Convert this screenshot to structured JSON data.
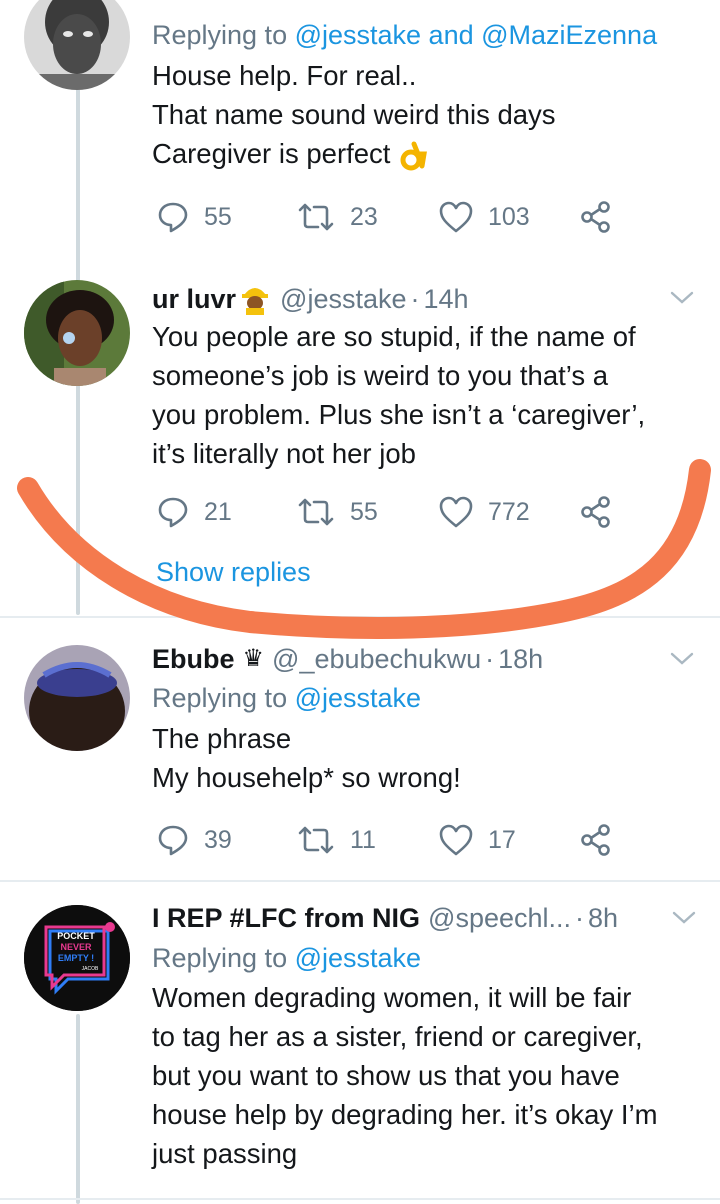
{
  "tweets": [
    {
      "replying_prefix": "Replying to ",
      "replying_mentions": "@jesstake and @MaziEzenna",
      "lines": [
        "House help. For real..",
        "That name sound weird this days",
        "Caregiver is perfect"
      ],
      "emoji_icon": "ok-hand-icon",
      "stats": {
        "replies": "55",
        "retweets": "23",
        "likes": "103"
      }
    },
    {
      "display_name": "ur luvr",
      "emoji_icon": "construction-worker-icon",
      "handle": "@jesstake",
      "dot": "·",
      "time": "14h",
      "lines": [
        "You people are so stupid, if the name of",
        "someone’s job is weird to you that’s a",
        "you problem. Plus she isn’t a ‘caregiver’,",
        "it’s literally not her job"
      ],
      "stats": {
        "replies": "21",
        "retweets": "55",
        "likes": "772"
      },
      "show_replies": "Show replies"
    },
    {
      "display_name": "Ebube",
      "name_symbol": "♛",
      "handle": "@_ebubechukwu",
      "dot": "·",
      "time": "18h",
      "replying_prefix": "Replying to ",
      "replying_mentions": "@jesstake",
      "lines": [
        "The phrase",
        "My househelp* so wrong!"
      ],
      "stats": {
        "replies": "39",
        "retweets": "11",
        "likes": "17"
      }
    },
    {
      "display_name": "I REP #LFC from NIG",
      "handle": "@speechl...",
      "dot": "·",
      "time": "8h",
      "replying_prefix": "Replying to ",
      "replying_mentions": "@jesstake",
      "lines": [
        "Women degrading women, it will be fair",
        "to tag her as a sister, friend or caregiver,",
        "but you want to show us that you have",
        "house help by degrading her. it’s okay I’m",
        "just passing"
      ],
      "avatar_text": [
        "POCKET",
        "NEVER",
        "EMPTY !",
        "JACOB"
      ]
    }
  ],
  "colors": {
    "link": "#1b95e0",
    "secondary": "#657786",
    "scribble": "#f47a4e",
    "divider": "#e6ecf0"
  }
}
